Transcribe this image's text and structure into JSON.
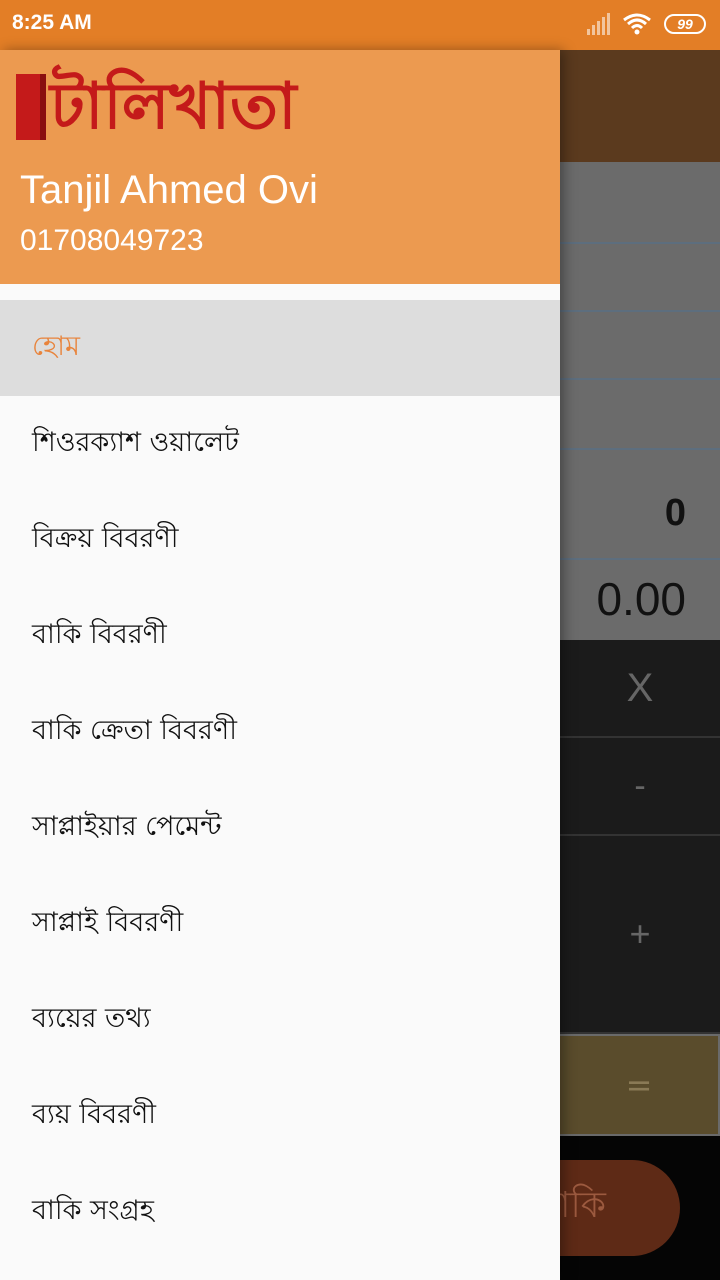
{
  "status_bar": {
    "time": "8:25 AM",
    "battery": "99"
  },
  "background": {
    "count_value": "0",
    "amount_value": "0.00",
    "keys": {
      "multiply": "X",
      "minus": "-",
      "plus": "+",
      "equals": "="
    },
    "fab_label": "বাকি"
  },
  "drawer": {
    "logo_text": "টালিখাতা",
    "user_name": "Tanjil Ahmed Ovi",
    "user_phone": "01708049723",
    "menu": [
      {
        "label": "হোম",
        "active": true
      },
      {
        "label": "শিওরক্যাশ ওয়ালেট"
      },
      {
        "label": "বিক্রয় বিবরণী"
      },
      {
        "label": "বাকি বিবরণী"
      },
      {
        "label": "বাকি ক্রেতা বিবরণী"
      },
      {
        "label": "সাপ্লাইয়ার পেমেন্ট"
      },
      {
        "label": "সাপ্লাই বিবরণী"
      },
      {
        "label": "ব্যয়ের তথ্য"
      },
      {
        "label": "ব্যয় বিবরণী"
      },
      {
        "label": "বাকি সংগ্রহ"
      }
    ]
  }
}
